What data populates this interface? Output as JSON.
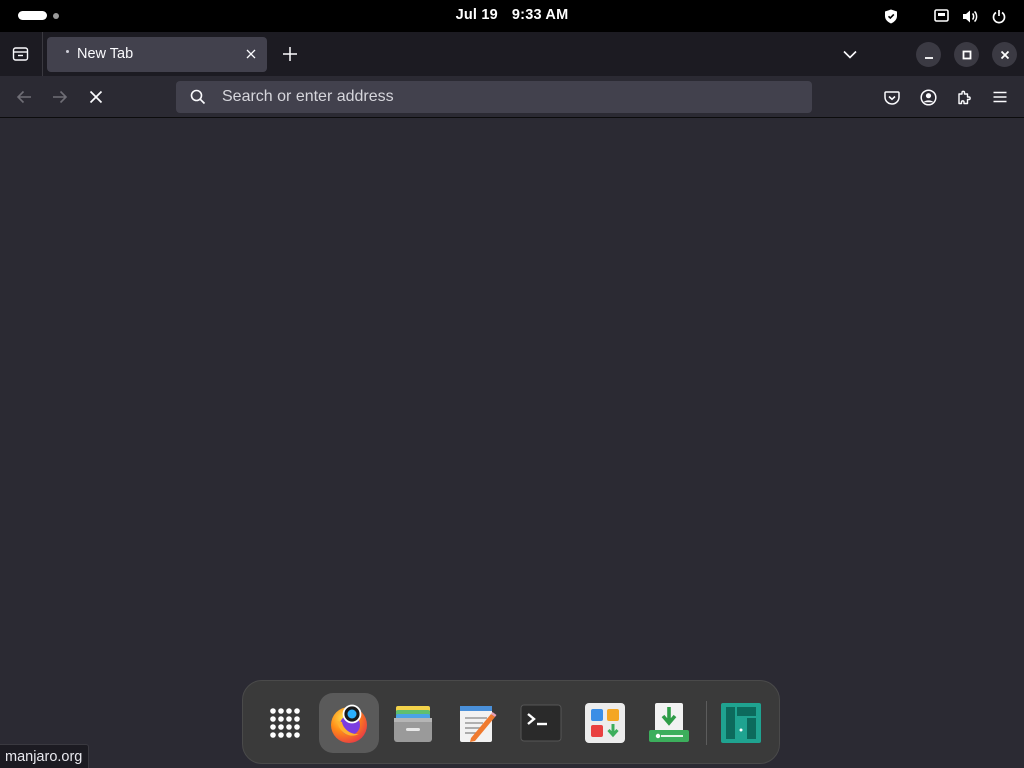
{
  "topbar": {
    "date": "Jul 19",
    "time": "9:33 AM",
    "icons": [
      "activities-indicator",
      "shield-icon",
      "network-wired-icon",
      "volume-icon",
      "power-icon"
    ]
  },
  "browser": {
    "tab": {
      "title": "New Tab"
    },
    "urlbar": {
      "placeholder": "Search or enter address",
      "value": ""
    },
    "toolbar_icons": [
      "back-arrow-icon",
      "forward-arrow-icon",
      "stop-icon",
      "pocket-icon",
      "account-icon",
      "extensions-icon",
      "hamburger-menu-icon"
    ],
    "window_controls": [
      "minimize-icon",
      "maximize-icon",
      "close-icon"
    ],
    "status_text": "manjaro.org",
    "colors": {
      "tabbar": "#1c1b22",
      "toolbar": "#2b2a33",
      "tab_active": "#42414d",
      "urlbar": "#42414d",
      "content": "#2b2a33"
    }
  },
  "dock": {
    "items": [
      {
        "name": "Show Applications",
        "icon": "app-grid-icon"
      },
      {
        "name": "Firefox",
        "icon": "firefox-icon",
        "active": true
      },
      {
        "name": "Files",
        "icon": "files-icon"
      },
      {
        "name": "Text Editor",
        "icon": "text-editor-icon"
      },
      {
        "name": "Terminal",
        "icon": "terminal-icon"
      },
      {
        "name": "Add/Remove Software",
        "icon": "software-icon"
      },
      {
        "name": "Software Installer",
        "icon": "installer-icon"
      },
      {
        "name": "Manjaro Hello",
        "icon": "manjaro-icon"
      }
    ],
    "colors": {
      "background": "#3a3a3a",
      "active": "#5a5a5a",
      "manjaro": "#1fa390"
    }
  }
}
